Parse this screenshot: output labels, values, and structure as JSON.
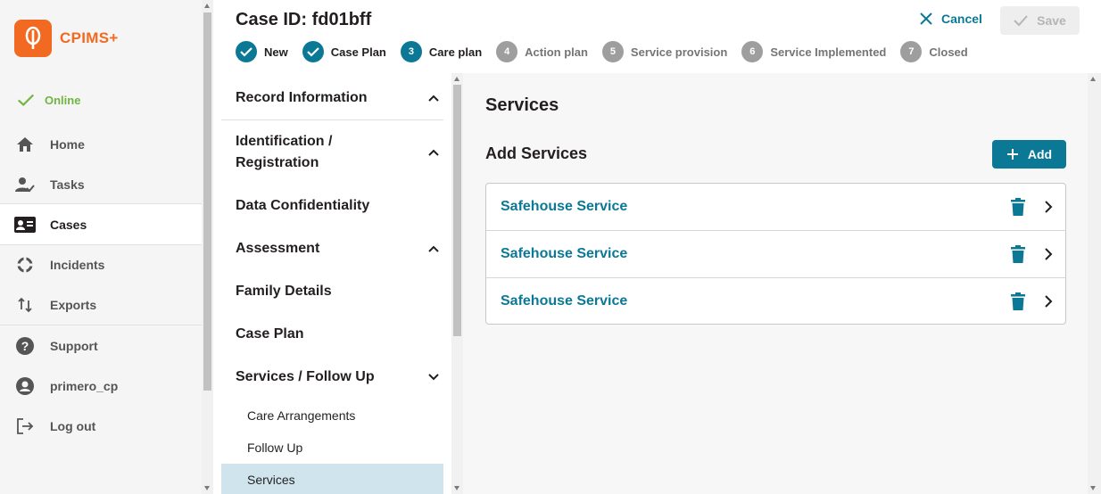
{
  "app": {
    "name": "CPIMS+"
  },
  "status": {
    "label": "Online",
    "color": "#6fb542"
  },
  "nav": {
    "items": [
      {
        "label": "Home",
        "icon": "home-icon"
      },
      {
        "label": "Tasks",
        "icon": "tasks-icon"
      },
      {
        "label": "Cases",
        "icon": "cases-icon"
      },
      {
        "label": "Incidents",
        "icon": "incidents-icon"
      },
      {
        "label": "Exports",
        "icon": "exports-icon"
      },
      {
        "label": "Support",
        "icon": "support-icon"
      },
      {
        "label": "primero_cp",
        "icon": "account-icon"
      },
      {
        "label": "Log out",
        "icon": "logout-icon"
      }
    ]
  },
  "header": {
    "title": "Case ID: fd01bff",
    "cancel_label": "Cancel",
    "save_label": "Save"
  },
  "steps": [
    {
      "num": "1",
      "label": "New",
      "state": "done"
    },
    {
      "num": "2",
      "label": "Case Plan",
      "state": "done"
    },
    {
      "num": "3",
      "label": "Care plan",
      "state": "current"
    },
    {
      "num": "4",
      "label": "Action plan",
      "state": "todo"
    },
    {
      "num": "5",
      "label": "Service provision",
      "state": "todo"
    },
    {
      "num": "6",
      "label": "Service Implemented",
      "state": "todo"
    },
    {
      "num": "7",
      "label": "Closed",
      "state": "todo"
    }
  ],
  "sections": {
    "record_information": "Record Information",
    "identification_registration": "Identification / Registration",
    "data_confidentiality": "Data Confidentiality",
    "assessment": "Assessment",
    "family_details": "Family Details",
    "case_plan": "Case Plan",
    "services_follow_up": "Services / Follow Up",
    "sub_items": [
      "Care Arrangements",
      "Follow Up",
      "Services"
    ]
  },
  "main": {
    "title": "Services",
    "add_title": "Add Services",
    "add_label": "Add",
    "services": [
      "Safehouse Service",
      "Safehouse Service",
      "Safehouse Service"
    ]
  },
  "colors": {
    "accent": "#0b7995",
    "brand": "#f26a21",
    "active_sub_bg": "#cfe4ec"
  }
}
